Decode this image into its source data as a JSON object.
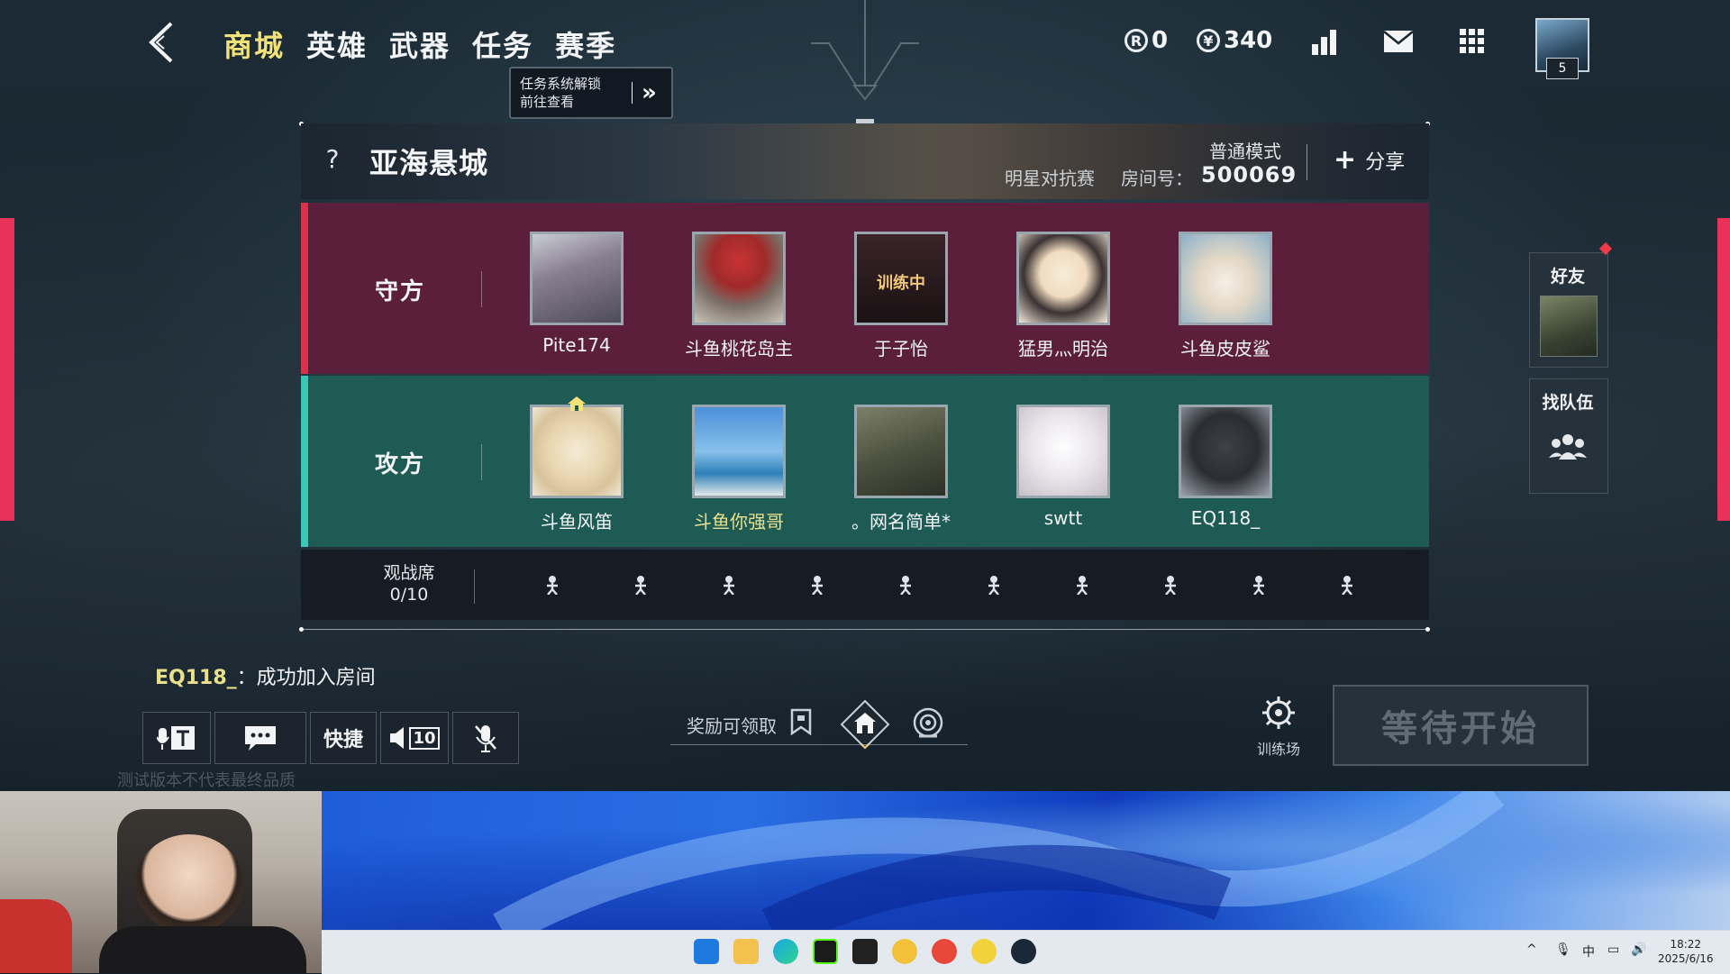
{
  "nav": {
    "tabs": [
      "商城",
      "英雄",
      "武器",
      "任务",
      "赛季"
    ],
    "active": "商城",
    "tooltip_line1": "任务系统解锁",
    "tooltip_line2": "前往查看"
  },
  "currency": {
    "r_points": "0",
    "coins": "340"
  },
  "profile": {
    "level": "5"
  },
  "room": {
    "map_name": "亚海悬城",
    "mode": "普通模式",
    "match_type": "明星对抗赛",
    "room_id_label": "房间号：",
    "room_id": "500069",
    "share_label": "分享"
  },
  "defenders": {
    "label": "守方",
    "players": [
      {
        "name": "Pite174"
      },
      {
        "name": "斗鱼桃花岛主"
      },
      {
        "name": "于子怡",
        "status": "训练中"
      },
      {
        "name": "猛男灬明治"
      },
      {
        "name": "斗鱼皮皮鲨"
      }
    ]
  },
  "attackers": {
    "label": "攻方",
    "players": [
      {
        "name": "斗鱼风笛",
        "host": true
      },
      {
        "name": "斗鱼你强哥",
        "highlight": true
      },
      {
        "name": "。网名简单*"
      },
      {
        "name": "swtt"
      },
      {
        "name": "EQ118_"
      }
    ]
  },
  "spectators": {
    "label": "观战席",
    "count": "0/10",
    "seats": 10
  },
  "side": {
    "friends_label": "好友",
    "find_team_label": "找队伍"
  },
  "chat": {
    "who": "EQ118_",
    "message": "：成功加入房间"
  },
  "bottom": {
    "quick_label": "快捷",
    "volume_label": "10",
    "reward_label": "奖励可领取",
    "training_label": "训练场",
    "start_label": "等待开始",
    "watermark": "测试版本不代表最终品质"
  },
  "system": {
    "time": "18:22",
    "date": "2025/6/16",
    "ime": "中"
  },
  "colors": {
    "defender": "#5b1f3c",
    "attacker": "#1f5b55",
    "accent": "#e8325a",
    "active_tab": "#f2e27a"
  }
}
